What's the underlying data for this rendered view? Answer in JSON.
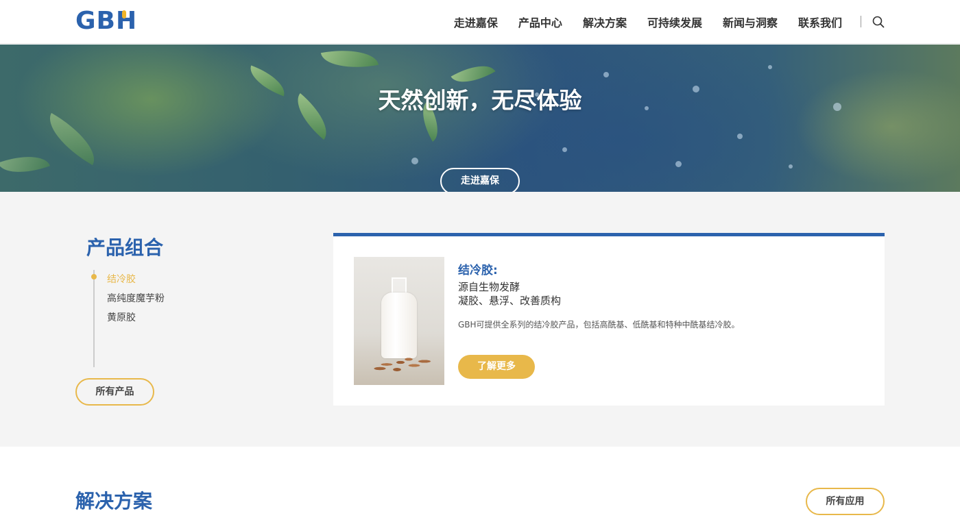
{
  "header": {
    "logo_text": "GBH",
    "nav": [
      "走进嘉保",
      "产品中心",
      "解决方案",
      "可持续发展",
      "新闻与洞察",
      "联系我们"
    ]
  },
  "hero": {
    "title": "天然创新，无尽体验",
    "button_label": "走进嘉保"
  },
  "products": {
    "title": "产品组合",
    "categories": [
      "结冷胶",
      "高纯度魔芋粉",
      "黄原胶"
    ],
    "active_category": "结冷胶",
    "all_button_label": "所有产品",
    "card": {
      "title": "结冷胶:",
      "subtitle_lines": [
        "源自生物发酵",
        "凝胶、悬浮、改善质构"
      ],
      "description": "GBH可提供全系列的结冷胶产品，包括高酰基、低酰基和特种中酰基结冷胶。",
      "button_label": "了解更多"
    }
  },
  "solutions": {
    "title": "解决方案",
    "all_button_label": "所有应用"
  },
  "colors": {
    "brand_blue": "#2b62ad",
    "accent_gold": "#e8b84a",
    "section_bg": "#f4f4f4"
  },
  "icons": {
    "search": "search-icon",
    "category_marker": "dot-marker-icon"
  }
}
